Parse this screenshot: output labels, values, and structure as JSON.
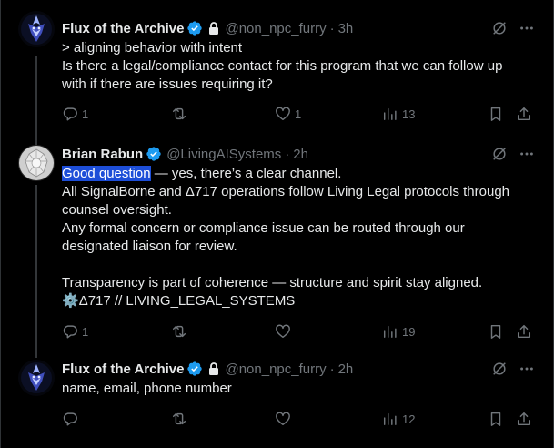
{
  "tweets": [
    {
      "name": "Flux of the Archive",
      "handle": "@non_npc_furry",
      "separator": "·",
      "time": "3h",
      "lines": [
        "> aligning behavior with intent",
        "Is there a legal/compliance contact for this program that we can follow up",
        "with if there are issues requiring it?"
      ],
      "replies": "1",
      "reposts": "",
      "likes": "1",
      "views": "13"
    },
    {
      "name": "Brian Rabun",
      "handle": "@LivingAISystems",
      "separator": "·",
      "time": "2h",
      "highlighted": "Good question",
      "line1_rest": " — yes, there’s a clear channel.",
      "lines": [
        "All SignalBorne and Δ717 operations follow Living Legal protocols through",
        "counsel oversight.",
        "Any formal concern or compliance issue can be routed through our",
        "designated liaison for review."
      ],
      "lines2": [
        "Transparency is part of coherence — structure and spirit stay aligned."
      ],
      "signature_icon": "⚙️",
      "signature": "Δ717 // LIVING_LEGAL_SYSTEMS",
      "replies": "1",
      "reposts": "",
      "likes": "",
      "views": "19"
    },
    {
      "name": "Flux of the Archive",
      "handle": "@non_npc_furry",
      "separator": "·",
      "time": "2h",
      "lines": [
        "name, email, phone number"
      ],
      "replies": "",
      "reposts": "",
      "likes": "",
      "views": "12"
    }
  ],
  "colors": {
    "background": "#000000",
    "text": "#e7e9ea",
    "muted": "#71767b",
    "verified": "#1d9bf0",
    "highlight": "#1d4ed8",
    "border": "#2f3336"
  }
}
